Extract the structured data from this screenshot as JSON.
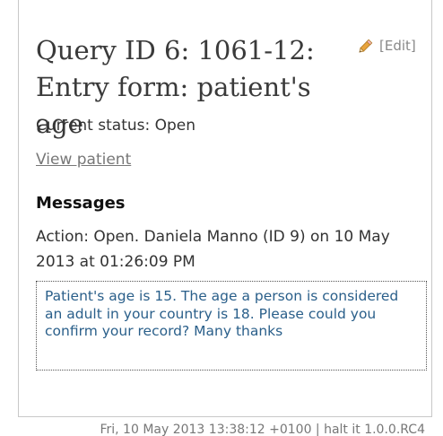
{
  "query": {
    "title": "Query ID 6: 1061-12: Entry form: patient's age",
    "edit_label": "[Edit]",
    "edit_icon": "pencil-icon",
    "status": "Current status: Open",
    "view_patient_label": "View patient"
  },
  "messages": {
    "heading": "Messages",
    "action": "Action: Open. Daniela Manno (ID 9) on 10 May 2013 at 01:26:09 PM",
    "body": "Patient's age is 15. The age a person is considered an adult in your country is 18. Please could you confirm your record? Many thanks"
  },
  "footer": {
    "text": "Fri, 10 May 2013 13:38:12 +0100 | halt it 1.0.0.RC4"
  },
  "colors": {
    "message_text": "#2a5f8a",
    "pencil": "#e8a33c"
  }
}
